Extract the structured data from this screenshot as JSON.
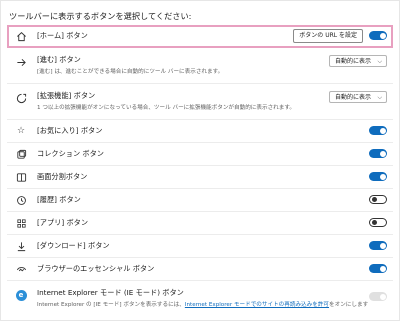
{
  "section_heading": "ツールバーに表示するボタンを選択してください:",
  "rows": {
    "home": {
      "icon": "home-icon",
      "label": "[ホーム] ボタン",
      "button_label": "ボタンの URL を設定",
      "toggle": "on"
    },
    "forward": {
      "icon": "forward-arrow-icon",
      "label": "[進む] ボタン",
      "description": "[進む] は、進むことができる場合に自動的にツール バーに表示されます。",
      "select_value": "自動的に表示"
    },
    "extensions": {
      "icon": "extensions-puzzle-icon",
      "label": "[拡張機能] ボタン",
      "description": "1 つ以上の拡張機能がオンになっている場合、ツール バーに拡張機能ボタンが自動的に表示されます。",
      "select_value": "自動的に表示"
    },
    "favorites": {
      "icon": "favorites-star-icon",
      "label": "[お気に入り] ボタン",
      "toggle": "on"
    },
    "collections": {
      "icon": "collections-icon",
      "label": "コレクション ボタン",
      "toggle": "on"
    },
    "split_screen": {
      "icon": "split-screen-icon",
      "label": "画面分割ボタン",
      "toggle": "on"
    },
    "history": {
      "icon": "history-icon",
      "label": "[履歴] ボタン",
      "toggle": "off"
    },
    "apps": {
      "icon": "apps-grid-icon",
      "label": "[アプリ] ボタン",
      "toggle": "off"
    },
    "downloads": {
      "icon": "download-icon",
      "label": "[ダウンロード] ボタン",
      "toggle": "on"
    },
    "essentials": {
      "icon": "browser-essentials-icon",
      "label": "ブラウザーのエッセンシャル ボタン",
      "toggle": "on"
    },
    "ie_mode": {
      "icon": "internet-explorer-icon",
      "label": "Internet Explorer モード (IE モード) ボタン",
      "description_prefix": "Internet Explorer の [IE モード] ボタンを表示するには、",
      "description_link": "Internet Explorer モードでのサイトの再読み込みを許可",
      "description_suffix": "をオンにします",
      "toggle": "disabled"
    }
  },
  "colors": {
    "accent": "#0f6cbd",
    "highlight_outline": "#e8a0c0"
  }
}
